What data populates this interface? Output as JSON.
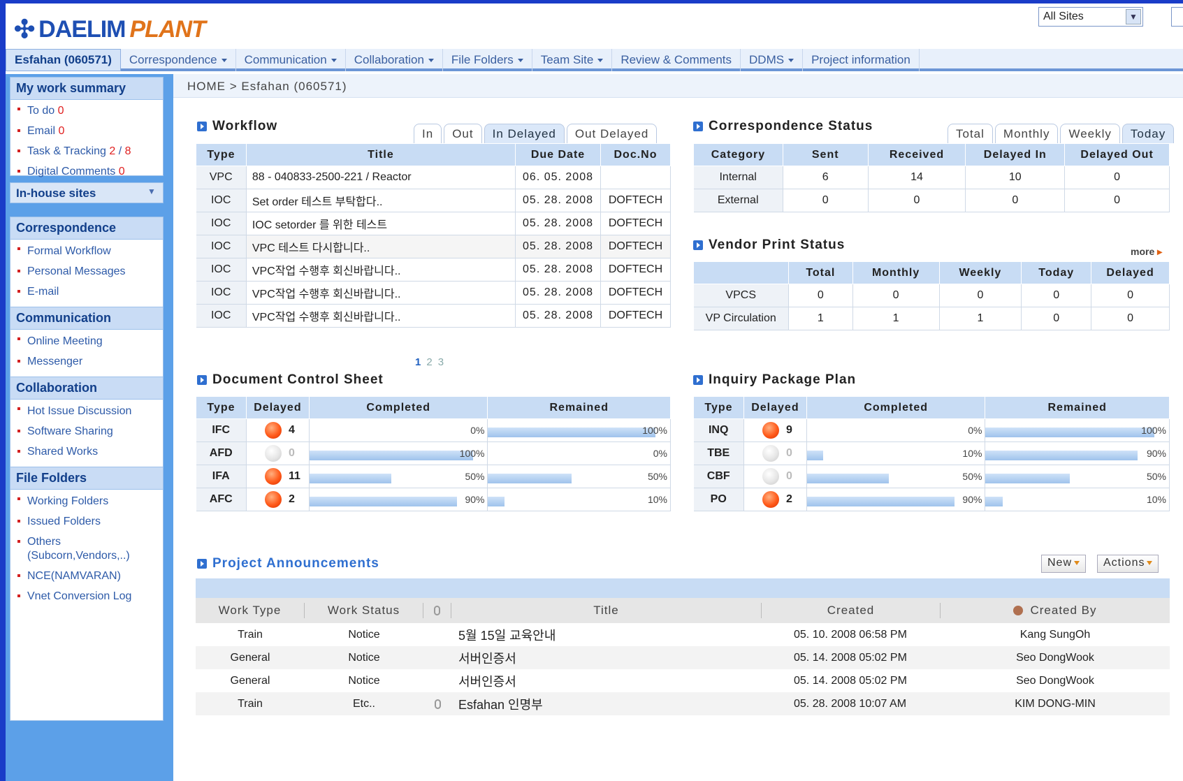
{
  "brand": {
    "daelim": "DAELIM",
    "plant": "PLANT",
    "site_select": "All Sites"
  },
  "topnav": [
    {
      "label": "Esfahan (060571)",
      "active": true,
      "dropdown": false
    },
    {
      "label": "Correspondence",
      "dropdown": true
    },
    {
      "label": "Communication",
      "dropdown": true
    },
    {
      "label": "Collaboration",
      "dropdown": true
    },
    {
      "label": "File Folders",
      "dropdown": true
    },
    {
      "label": "Team Site",
      "dropdown": true
    },
    {
      "label": "Review & Comments",
      "dropdown": false
    },
    {
      "label": "DDMS",
      "dropdown": true
    },
    {
      "label": "Project information",
      "dropdown": false
    }
  ],
  "sidebar": {
    "summary_title": "My work summary",
    "summary": {
      "todo_label": "To do",
      "todo_count": "0",
      "email_label": "Email",
      "email_count": "0",
      "task_label": "Task & Tracking",
      "task_a": "2",
      "task_sep": "/",
      "task_b": "8",
      "digital_label": "Digital Comments",
      "digital_count": "0"
    },
    "inhouse": "In-house sites",
    "correspondence": {
      "title": "Correspondence",
      "items": [
        "Formal Workflow",
        "Personal Messages",
        "E-mail"
      ]
    },
    "communication": {
      "title": "Communication",
      "items": [
        "Online Meeting",
        "Messenger"
      ]
    },
    "collaboration": {
      "title": "Collaboration",
      "items": [
        "Hot Issue Discussion",
        "Software Sharing",
        "Shared Works"
      ]
    },
    "file_folders": {
      "title": "File Folders",
      "items": [
        "Working Folders",
        "Issued Folders",
        "Others",
        "(Subcorn,Vendors,..)",
        "NCE(NAMVARAN)",
        "Vnet Conversion Log"
      ]
    }
  },
  "breadcrumb": "HOME > Esfahan (060571)",
  "workflow": {
    "title": "Workflow",
    "tabs": [
      "In",
      "Out",
      "In Delayed",
      "Out Delayed"
    ],
    "active_tab": "In Delayed",
    "headers": [
      "Type",
      "Title",
      "Due Date",
      "Doc.No"
    ],
    "rows": [
      [
        "VPC",
        "88 - 040833-2500-221 / Reactor",
        "06. 05. 2008",
        ""
      ],
      [
        "IOC",
        "Set order 테스트 부탁합다..",
        "05. 28. 2008",
        "DOFTECH"
      ],
      [
        "IOC",
        "IOC setorder 를 위한 테스트",
        "05. 28. 2008",
        "DOFTECH"
      ],
      [
        "IOC",
        "VPC 테스트 다시합니다..",
        "05. 28. 2008",
        "DOFTECH"
      ],
      [
        "IOC",
        "VPC작업 수행후 회신바랍니다..",
        "05. 28. 2008",
        "DOFTECH"
      ],
      [
        "IOC",
        "VPC작업 수행후 회신바랍니다..",
        "05. 28. 2008",
        "DOFTECH"
      ],
      [
        "IOC",
        "VPC작업 수행후 회신바랍니다..",
        "05. 28. 2008",
        "DOFTECH"
      ]
    ],
    "pages": [
      "1",
      "2",
      "3"
    ]
  },
  "corr_status": {
    "title": "Correspondence Status",
    "tabs": [
      "Total",
      "Monthly",
      "Weekly",
      "Today"
    ],
    "active_tab": "Today",
    "headers": [
      "Category",
      "Sent",
      "Received",
      "Delayed In",
      "Delayed Out"
    ],
    "rows": [
      [
        "Internal",
        "6",
        "14",
        "10",
        "0"
      ],
      [
        "External",
        "0",
        "0",
        "0",
        "0"
      ]
    ]
  },
  "vendor_status": {
    "title": "Vendor Print Status",
    "more": "more",
    "headers": [
      "",
      "Total",
      "Monthly",
      "Weekly",
      "Today",
      "Delayed"
    ],
    "rows": [
      [
        "VPCS",
        "0",
        "0",
        "0",
        "0",
        "0"
      ],
      [
        "VP Circulation",
        "1",
        "1",
        "1",
        "0",
        "0"
      ]
    ]
  },
  "doc_control": {
    "title": "Document Control Sheet",
    "headers": [
      "Type",
      "Delayed",
      "Completed",
      "Remained"
    ],
    "rows": [
      {
        "type": "IFC",
        "delayed": "4",
        "flag": true,
        "completed": 0,
        "remained": 100,
        "c_label": "0%",
        "r_label": "100%"
      },
      {
        "type": "AFD",
        "delayed": "0",
        "flag": false,
        "completed": 100,
        "remained": 0,
        "c_label": "100%",
        "r_label": "0%"
      },
      {
        "type": "IFA",
        "delayed": "11",
        "flag": true,
        "completed": 50,
        "remained": 50,
        "c_label": "50%",
        "r_label": "50%"
      },
      {
        "type": "AFC",
        "delayed": "2",
        "flag": true,
        "completed": 90,
        "remained": 10,
        "c_label": "90%",
        "r_label": "10%"
      }
    ]
  },
  "inquiry": {
    "title": "Inquiry Package Plan",
    "headers": [
      "Type",
      "Delayed",
      "Completed",
      "Remained"
    ],
    "rows": [
      {
        "type": "INQ",
        "delayed": "9",
        "flag": true,
        "completed": 0,
        "remained": 100,
        "c_label": "0%",
        "r_label": "100%"
      },
      {
        "type": "TBE",
        "delayed": "0",
        "flag": false,
        "completed": 10,
        "remained": 90,
        "c_label": "10%",
        "r_label": "90%"
      },
      {
        "type": "CBF",
        "delayed": "0",
        "flag": false,
        "completed": 50,
        "remained": 50,
        "c_label": "50%",
        "r_label": "50%"
      },
      {
        "type": "PO",
        "delayed": "2",
        "flag": true,
        "completed": 90,
        "remained": 10,
        "c_label": "90%",
        "r_label": "10%"
      }
    ]
  },
  "announcements": {
    "title": "Project Announcements",
    "new_btn": "New",
    "actions_btn": "Actions",
    "headers": [
      "Work Type",
      "Work Status",
      "Title",
      "Created",
      "Created By"
    ],
    "rows": [
      {
        "type": "Train",
        "status": "Notice",
        "attach": false,
        "title": "5월 15일 교육안내",
        "created": "05. 10. 2008 06:58 PM",
        "by": "Kang SungOh"
      },
      {
        "type": "General",
        "status": "Notice",
        "attach": false,
        "title": "서버인증서",
        "created": "05. 14. 2008 05:02 PM",
        "by": "Seo DongWook"
      },
      {
        "type": "General",
        "status": "Notice",
        "attach": false,
        "title": "서버인증서",
        "created": "05. 14. 2008 05:02 PM",
        "by": "Seo DongWook"
      },
      {
        "type": "Train",
        "status": "Etc..",
        "attach": true,
        "title": "Esfahan 인명부",
        "created": "05. 28. 2008 10:07 AM",
        "by": "KIM DONG-MIN"
      }
    ]
  }
}
